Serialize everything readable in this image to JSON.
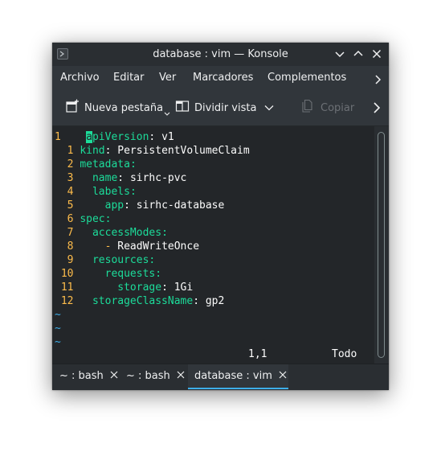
{
  "window": {
    "title": "database : vim — Konsole"
  },
  "menu": [
    "Archivo",
    "Editar",
    "Ver",
    "Marcadores",
    "Complementos"
  ],
  "toolbar": {
    "new_tab": "Nueva pestaña",
    "split_view": "Dividir vista",
    "copy": "Copiar"
  },
  "editor": {
    "lines": [
      {
        "num": "1",
        "indent": "",
        "key": "apiVersion",
        "value": "v1"
      },
      {
        "num": "1",
        "indent": "",
        "key": "kind",
        "value": "PersistentVolumeClaim"
      },
      {
        "num": "2",
        "indent": "",
        "key": "metadata",
        "value": ""
      },
      {
        "num": "3",
        "indent": "  ",
        "key": "name",
        "value": "sirhc-pvc"
      },
      {
        "num": "4",
        "indent": "  ",
        "key": "labels",
        "value": ""
      },
      {
        "num": "5",
        "indent": "    ",
        "key": "app",
        "value": "sirhc-database"
      },
      {
        "num": "6",
        "indent": "",
        "key": "spec",
        "value": ""
      },
      {
        "num": "7",
        "indent": "  ",
        "key": "accessModes",
        "value": ""
      },
      {
        "num": "8",
        "indent": "    ",
        "key": "- ",
        "value": "ReadWriteOnce",
        "dash": true
      },
      {
        "num": "9",
        "indent": "  ",
        "key": "resources",
        "value": ""
      },
      {
        "num": "10",
        "indent": "    ",
        "key": "requests",
        "value": ""
      },
      {
        "num": "11",
        "indent": "      ",
        "key": "storage",
        "value": "1Gi"
      },
      {
        "num": "12",
        "indent": "  ",
        "key": "storageClassName",
        "value": "gp2"
      }
    ],
    "tildes": [
      "~",
      "~",
      "~"
    ],
    "status_position": "1,1",
    "status_scroll": "Todo"
  },
  "tabs": [
    {
      "label": "~ : bash",
      "active": false
    },
    {
      "label": "~ : bash",
      "active": false
    },
    {
      "label": "database : vim",
      "active": true
    }
  ],
  "colors": {
    "key": "#1cdc9a",
    "line_number": "#fdbc4b",
    "tilde": "#3daee9",
    "accent": "#3daee9"
  }
}
